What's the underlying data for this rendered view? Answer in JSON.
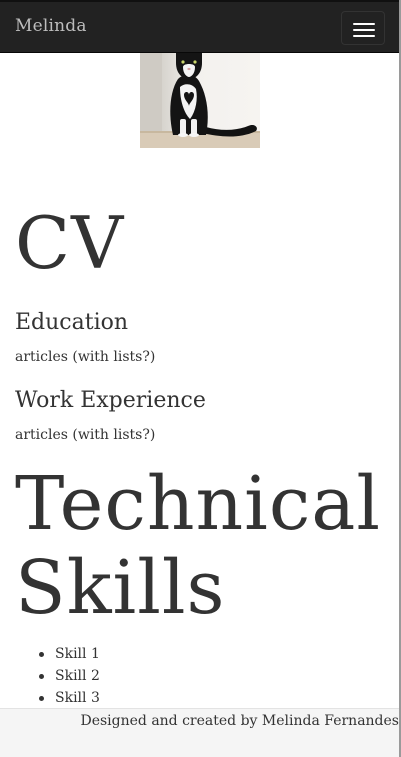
{
  "navbar": {
    "brand": "Melinda",
    "toggle_icon": "hamburger-menu-icon"
  },
  "profile": {
    "photo": "cat-photo"
  },
  "cv": {
    "title": "CV",
    "education": {
      "heading": "Education",
      "text": "articles (with lists?)"
    },
    "work": {
      "heading": "Work Experience",
      "text": "articles (with lists?)"
    }
  },
  "skills": {
    "title": "Technical Skills",
    "items": [
      "Skill 1",
      "Skill 2",
      "Skill 3"
    ]
  },
  "footer": {
    "text": "Designed and created by Melinda Fernandes"
  },
  "colors": {
    "navbar_bg": "#222222",
    "brand_text": "#bdbdbd",
    "body_text": "#333333",
    "footer_bg": "#f5f5f5"
  }
}
